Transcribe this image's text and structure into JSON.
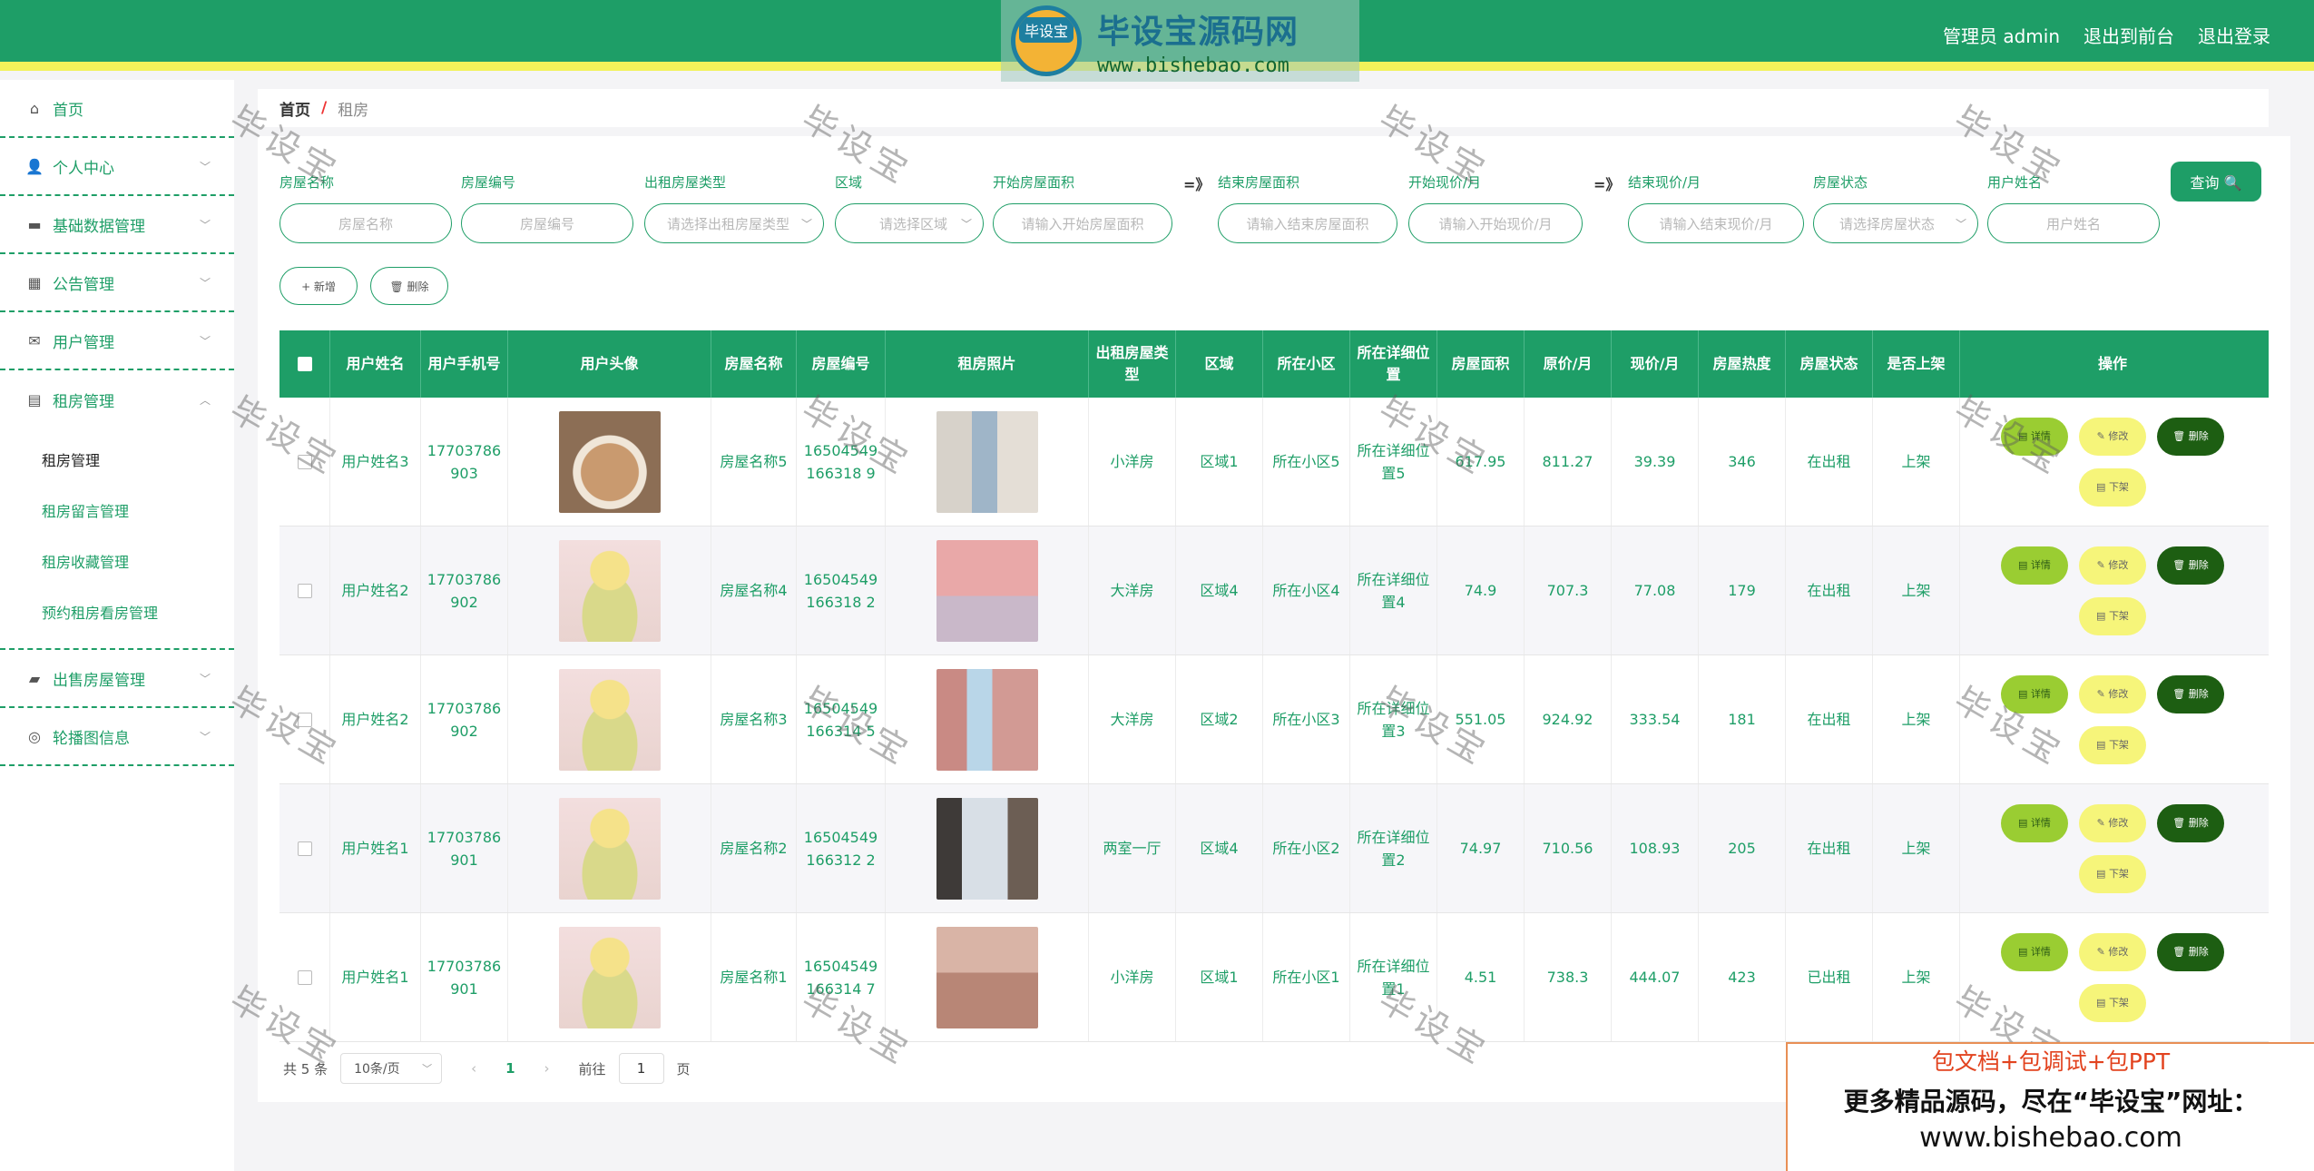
{
  "logo": {
    "badge": "毕设宝",
    "name": "毕设宝源码网",
    "url": "www.bishebao.com"
  },
  "header": {
    "admin": "管理员 admin",
    "to_front": "退出到前台",
    "logout": "退出登录"
  },
  "sidebar": {
    "home": "首页",
    "personal": "个人中心",
    "basic": "基础数据管理",
    "notice": "公告管理",
    "users": "用户管理",
    "rent": "租房管理",
    "rent_sub": [
      "租房管理",
      "租房留言管理",
      "租房收藏管理",
      "预约租房看房管理"
    ],
    "sale": "出售房屋管理",
    "carousel": "轮播图信息"
  },
  "breadcrumb": {
    "home": "首页",
    "sep": "/",
    "current": "租房"
  },
  "filters": {
    "house_name": {
      "label": "房屋名称",
      "placeholder": "房屋名称"
    },
    "house_no": {
      "label": "房屋编号",
      "placeholder": "房屋编号"
    },
    "rent_type": {
      "label": "出租房屋类型",
      "placeholder": "请选择出租房屋类型"
    },
    "area": {
      "label": "区域",
      "placeholder": "请选择区域"
    },
    "size_start": {
      "label": "开始房屋面积",
      "placeholder": "请输入开始房屋面积"
    },
    "size_end": {
      "label": "结束房屋面积",
      "placeholder": "请输入结束房屋面积"
    },
    "price_start": {
      "label": "开始现价/月",
      "placeholder": "请输入开始现价/月"
    },
    "price_end": {
      "label": "结束现价/月",
      "placeholder": "请输入结束现价/月"
    },
    "status": {
      "label": "房屋状态",
      "placeholder": "请选择房屋状态"
    },
    "username": {
      "label": "用户姓名",
      "placeholder": "用户姓名"
    },
    "arrow": "=》",
    "search": "查询 🔍"
  },
  "toolbar": {
    "add": "+ 新增",
    "delete": "🗑 删除"
  },
  "table": {
    "headers": [
      "用户姓名",
      "用户手机号",
      "用户头像",
      "房屋名称",
      "房屋编号",
      "租房照片",
      "出租房屋类型",
      "区域",
      "所在小区",
      "所在详细位置",
      "房屋面积",
      "原价/月",
      "现价/月",
      "房屋热度",
      "房屋状态",
      "是否上架",
      "操作"
    ],
    "rows": [
      {
        "user": "用户姓名3",
        "phone": "17703786903",
        "house": "房屋名称5",
        "no": "16504549166318 9",
        "type": "小洋房",
        "area": "区域1",
        "community": "所在小区5",
        "addr": "所在详细位置5",
        "size": "617.95",
        "orig": "811.27",
        "now": "39.39",
        "heat": "346",
        "status": "在出租",
        "shelf": "上架"
      },
      {
        "user": "用户姓名2",
        "phone": "17703786902",
        "house": "房屋名称4",
        "no": "16504549166318 2",
        "type": "大洋房",
        "area": "区域4",
        "community": "所在小区4",
        "addr": "所在详细位置4",
        "size": "74.9",
        "orig": "707.3",
        "now": "77.08",
        "heat": "179",
        "status": "在出租",
        "shelf": "上架"
      },
      {
        "user": "用户姓名2",
        "phone": "17703786902",
        "house": "房屋名称3",
        "no": "16504549166314 5",
        "type": "大洋房",
        "area": "区域2",
        "community": "所在小区3",
        "addr": "所在详细位置3",
        "size": "551.05",
        "orig": "924.92",
        "now": "333.54",
        "heat": "181",
        "status": "在出租",
        "shelf": "上架"
      },
      {
        "user": "用户姓名1",
        "phone": "17703786901",
        "house": "房屋名称2",
        "no": "16504549166312 2",
        "type": "两室一厅",
        "area": "区域4",
        "community": "所在小区2",
        "addr": "所在详细位置2",
        "size": "74.97",
        "orig": "710.56",
        "now": "108.93",
        "heat": "205",
        "status": "在出租",
        "shelf": "上架"
      },
      {
        "user": "用户姓名1",
        "phone": "17703786901",
        "house": "房屋名称1",
        "no": "16504549166314 7",
        "type": "小洋房",
        "area": "区域1",
        "community": "所在小区1",
        "addr": "所在详细位置1",
        "size": "4.51",
        "orig": "738.3",
        "now": "444.07",
        "heat": "423",
        "status": "已出租",
        "shelf": "上架"
      }
    ],
    "ops": {
      "detail": "详情",
      "edit": "修改",
      "remove": "删除",
      "offshelf": "下架"
    }
  },
  "pager": {
    "total": "共 5 条",
    "size": "10条/页",
    "prev": "‹",
    "page": "1",
    "next": "›",
    "goto": "前往",
    "jump": "1",
    "unit": "页"
  },
  "watermark": "毕设宝",
  "promo": {
    "line1": "包文档+包调试+包PPT",
    "line2": "更多精品源码，尽在“毕设宝”网址：",
    "line3": "www.bishebao.com"
  }
}
